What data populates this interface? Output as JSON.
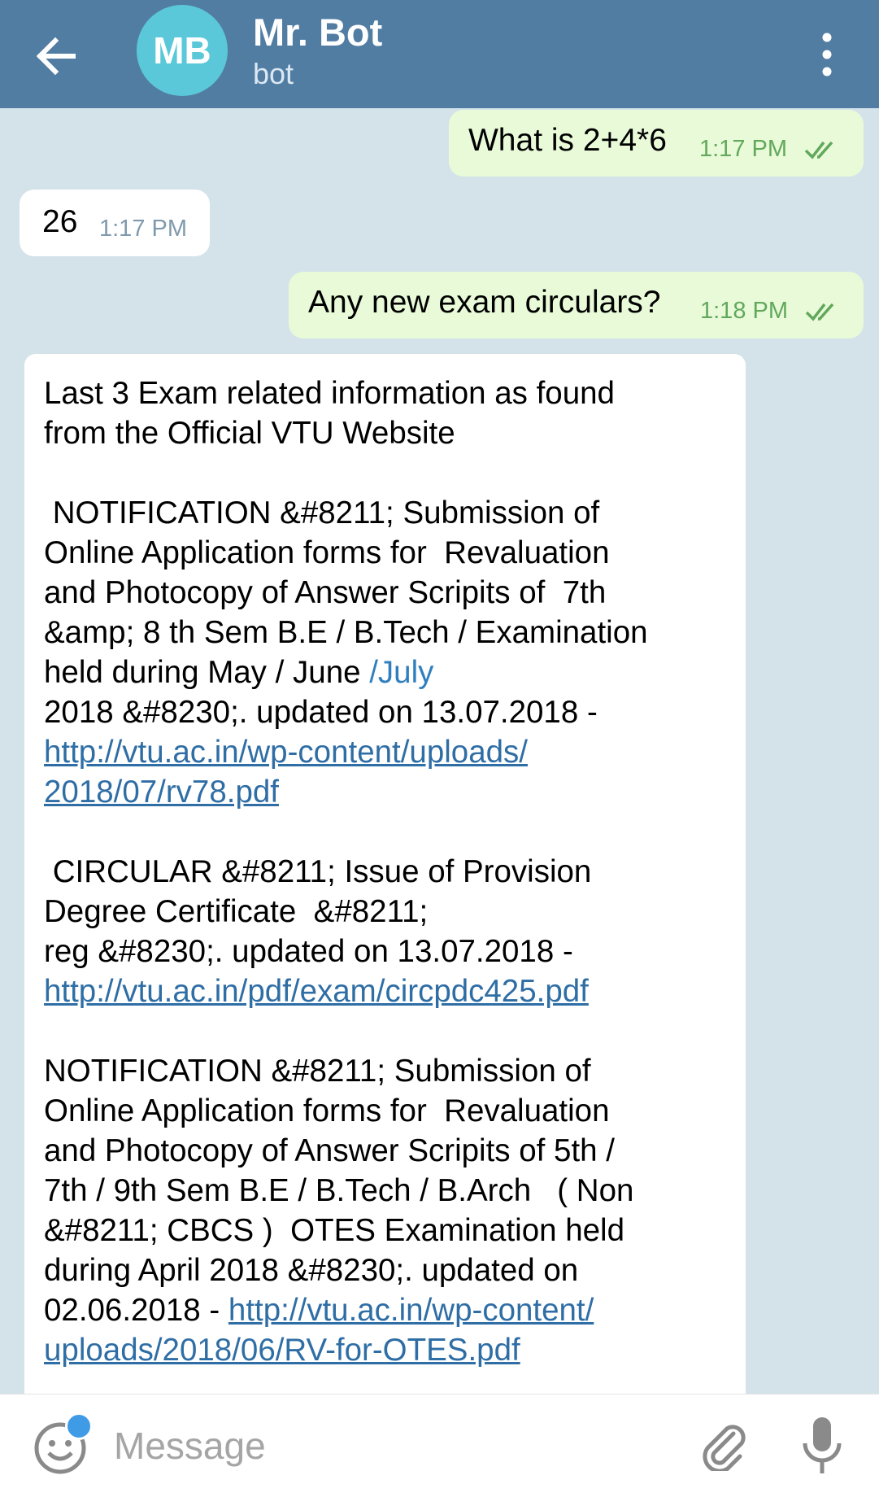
{
  "header": {
    "avatar_initials": "MB",
    "title": "Mr. Bot",
    "subtitle": "bot",
    "accent_color": "#527da3"
  },
  "messages": [
    {
      "direction": "outgoing",
      "text": "What is 2+4*6",
      "time": "1:17 PM",
      "status": "read"
    },
    {
      "direction": "incoming",
      "text": "26",
      "time": "1:17 PM"
    },
    {
      "direction": "outgoing",
      "text": "Any new exam circulars?",
      "time": "1:18 PM",
      "status": "read"
    }
  ],
  "long_message": {
    "intro": "Last 3 Exam related information as found\nfrom the Official VTU Website\n\n",
    "n1_text_a": " NOTIFICATION &#8211; Submission of\nOnline Application forms for  Revaluation\nand Photocopy of Answer Scripits of  7th\n&amp; 8 th Sem B.E / B.Tech / Examination\nheld during May / June ",
    "n1_highlight": "/July",
    "n1_text_b": "\n2018 &#8230;. updated on 13.07.2018 - \n",
    "n1_link": "http://vtu.ac.in/wp-content/uploads/\n2018/07/rv78.pdf",
    "c1_text": "\n\n CIRCULAR &#8211; Issue of Provision\nDegree Certificate  &#8211;\nreg &#8230;. updated on 13.07.2018 - \n",
    "c1_link": "http://vtu.ac.in/pdf/exam/circpdc425.pdf",
    "n2_text": "\n\nNOTIFICATION &#8211; Submission of\nOnline Application forms for  Revaluation\nand Photocopy of Answer Scripits of 5th /\n7th / 9th Sem B.E / B.Tech / B.Arch   ( Non\n&#8211; CBCS )  OTES Examination held\nduring April 2018 &#8230;. updated on\n02.06.2018 - ",
    "n2_link": "http://vtu.ac.in/wp-content/\nuploads/2018/06/RV-for-OTES.pdf"
  },
  "input": {
    "placeholder": "Message",
    "value": ""
  },
  "icons": {
    "back": "arrow-left-icon",
    "menu": "more-vertical-icon",
    "emoji": "emoji-icon",
    "attach": "paperclip-icon",
    "mic": "microphone-icon",
    "read": "double-check-icon"
  }
}
